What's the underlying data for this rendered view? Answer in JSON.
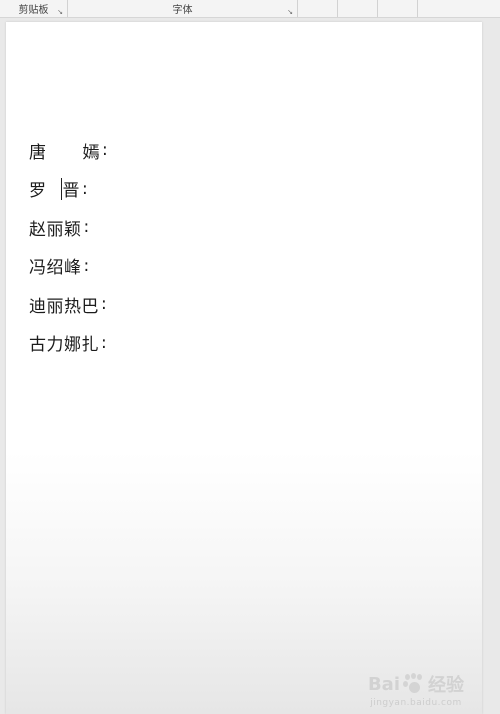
{
  "ribbon": {
    "clipboard_label": "剪贴板",
    "font_label": "字体",
    "launcher_glyph": "↘"
  },
  "document": {
    "lines": [
      {
        "part1": "唐",
        "part2": "嫣",
        "colon": ":"
      },
      {
        "part1": "罗",
        "part2": "晋",
        "colon": ":"
      },
      {
        "full": "赵丽颖",
        "colon": ":"
      },
      {
        "full": "冯绍峰",
        "colon": ":"
      },
      {
        "full": "迪丽热巴",
        "colon": ":"
      },
      {
        "full": "古力娜扎",
        "colon": ":"
      }
    ]
  },
  "watermark": {
    "brand_left": "Bai",
    "brand_right": "经验",
    "url": "jingyan.baidu.com"
  }
}
